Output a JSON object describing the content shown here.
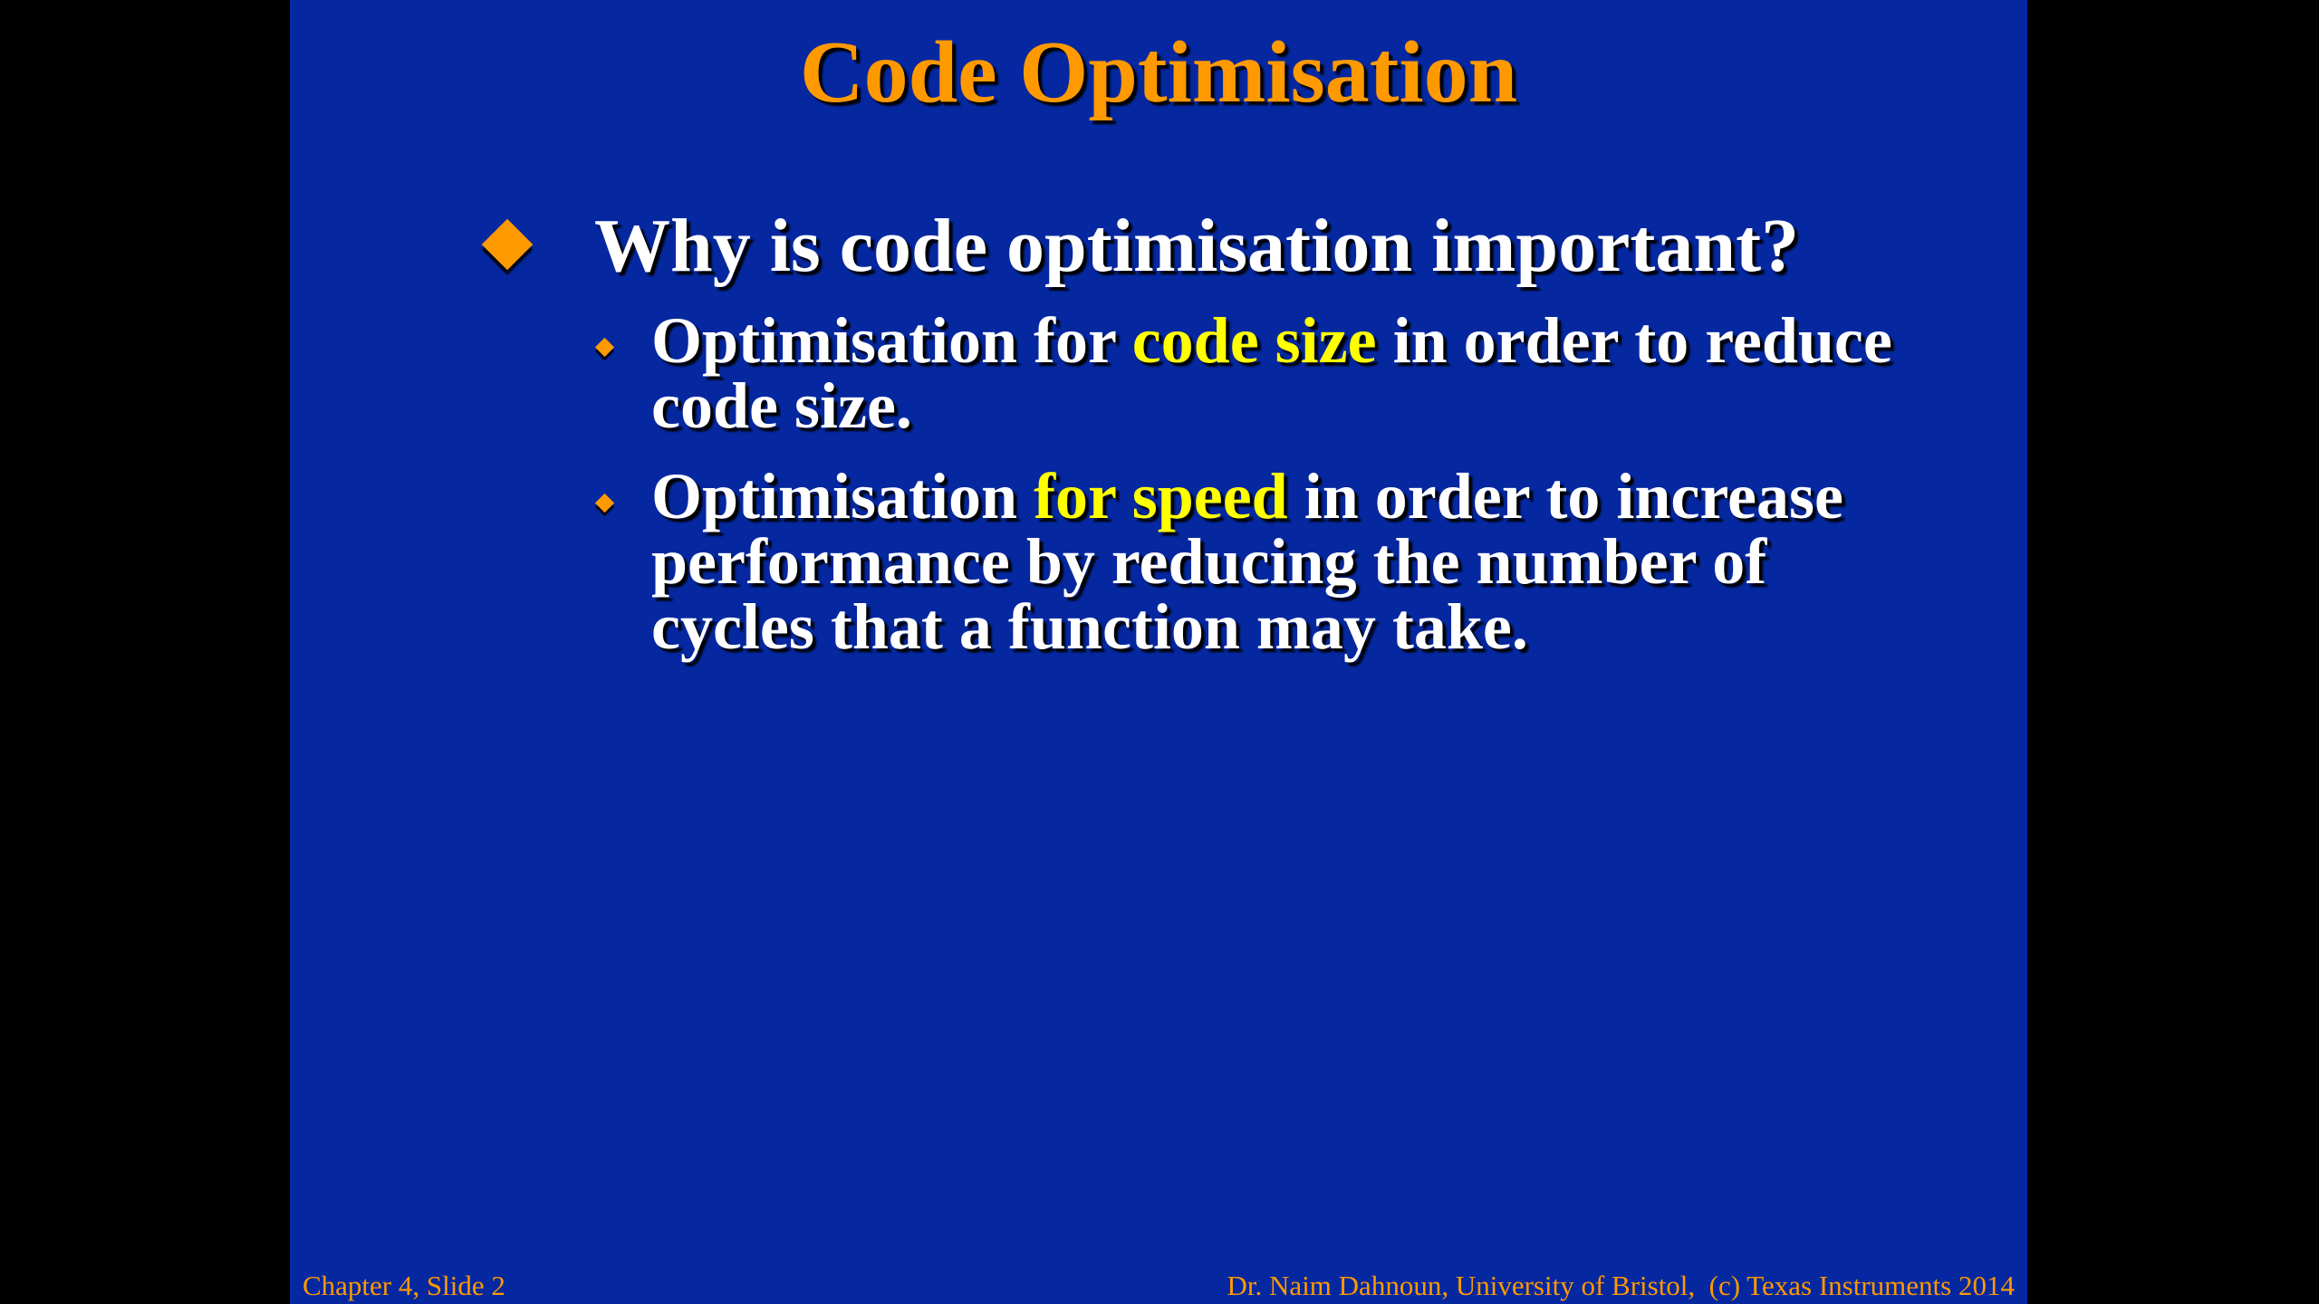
{
  "colors": {
    "slide_background": "#0528A0",
    "letterbox": "#000000",
    "title": "#FF9900",
    "body_text": "#FFFFFF",
    "highlight": "#FFFF00",
    "bullet": "#FF9900",
    "footer": "#FF9900"
  },
  "slide": {
    "title": "Code Optimisation",
    "main_bullet": {
      "icon": "diamond-bullet",
      "text": "Why is code optimisation important?"
    },
    "sub_bullets": [
      {
        "icon": "small-diamond-bullet",
        "line1_before": "Optimisation for ",
        "line1_highlight": "code size",
        "line1_after": " in order to reduce",
        "line2": "code size."
      },
      {
        "icon": "small-diamond-bullet",
        "line1_before": "Optimisation ",
        "line1_highlight": "for speed",
        "line1_after": " in order to increase",
        "line2": "performance by reducing the number of",
        "line3": "cycles that a function may take."
      }
    ]
  },
  "footer": {
    "left": "Chapter 4, Slide 2",
    "right": "Dr. Naim Dahnoun, University of Bristol,  (c) Texas Instruments 2014"
  }
}
